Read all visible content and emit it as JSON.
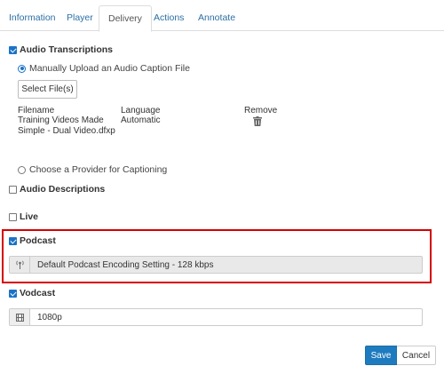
{
  "tabs": [
    {
      "label": "Information"
    },
    {
      "label": "Player"
    },
    {
      "label": "Delivery"
    },
    {
      "label": "Actions"
    },
    {
      "label": "Annotate"
    }
  ],
  "active_tab": "Delivery",
  "audio_transcriptions": {
    "label": "Audio Transcriptions",
    "checked": true,
    "manual_upload_label": "Manually Upload an Audio Caption File",
    "select_files_label": "Select File(s)",
    "columns": {
      "filename": "Filename",
      "language": "Language",
      "remove": "Remove"
    },
    "file": {
      "name_line1": "Training Videos Made",
      "name_line2": "Simple - Dual Video.dfxp",
      "language": "Automatic"
    },
    "provider_label": "Choose a Provider for Captioning"
  },
  "audio_descriptions": {
    "label": "Audio Descriptions",
    "checked": false
  },
  "live": {
    "label": "Live",
    "checked": false
  },
  "podcast": {
    "label": "Podcast",
    "checked": true,
    "setting": "Default Podcast Encoding Setting - 128 kbps"
  },
  "vodcast": {
    "label": "Vodcast",
    "checked": true,
    "setting": "1080p"
  },
  "footer": {
    "save_label": "Save",
    "cancel_label": "Cancel"
  },
  "colors": {
    "accent": "#1f7bbf",
    "highlight": "#d40000",
    "link": "#2a6fa6"
  }
}
